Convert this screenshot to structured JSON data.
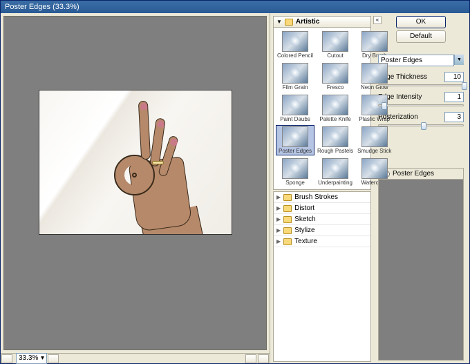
{
  "title": "Poster Edges (33.3%)",
  "zoom": "33.3%",
  "buttons": {
    "ok": "OK",
    "default": "Default"
  },
  "selected_filter": "Poster Edges",
  "sliders": [
    {
      "label": "Edge Thickness",
      "value": "10",
      "pos": 98
    },
    {
      "label": "Edge Intensity",
      "value": "1",
      "pos": 3
    },
    {
      "label": "Posterization",
      "value": "3",
      "pos": 50
    }
  ],
  "category_open": "Artistic",
  "filters": [
    "Colored Pencil",
    "Cutout",
    "Dry Brush",
    "Film Grain",
    "Fresco",
    "Neon Glow",
    "Paint Daubs",
    "Palette Knife",
    "Plastic Wrap",
    "Poster Edges",
    "Rough Pastels",
    "Smudge Stick",
    "Sponge",
    "Underpainting",
    "Watercolor"
  ],
  "selected_filter_index": 9,
  "categories": [
    "Brush Strokes",
    "Distort",
    "Sketch",
    "Stylize",
    "Texture"
  ],
  "preview_label": "Poster Edges"
}
